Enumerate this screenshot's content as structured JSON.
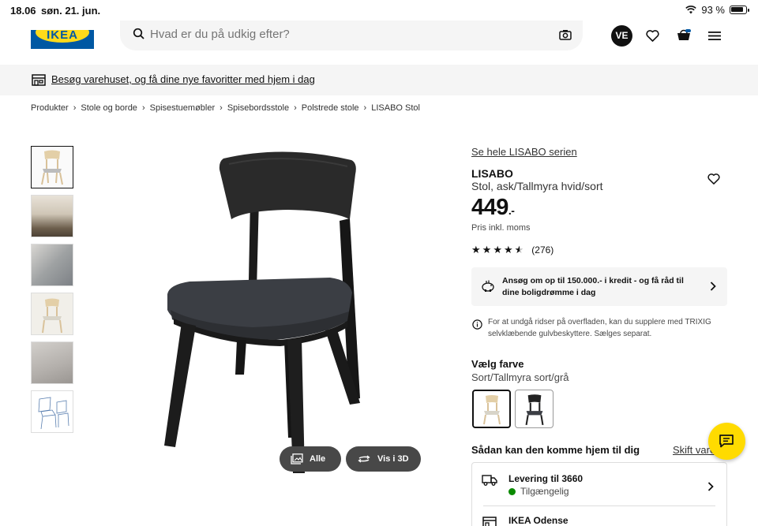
{
  "status_bar": {
    "time": "18.06",
    "date": "søn. 21. jun.",
    "url": "ikea.com",
    "battery": "93 %"
  },
  "header": {
    "logo_text": "IKEA",
    "search_placeholder": "Hvad er du på udkig efter?",
    "avatar_initials": "VE"
  },
  "banner": {
    "text": "Besøg varehuset, og få dine nye favoritter med hjem i dag"
  },
  "breadcrumb": [
    "Produkter",
    "Stole og borde",
    "Spisestuemøbler",
    "Spisebordsstole",
    "Polstrede stole",
    "LISABO Stol"
  ],
  "gallery": {
    "all_label": "Alle",
    "view_3d_label": "Vis i 3D"
  },
  "product": {
    "series_link": "Se hele LISABO serien",
    "name": "LISABO",
    "description": "Stol, ask/Tallmyra hvid/sort",
    "price": "449",
    "price_suffix": ".-",
    "vat_note": "Pris inkl. moms",
    "rating": 4.5,
    "review_count": "(276)",
    "credit_text": "Ansøg om op til 150.000.- i kredit - og få råd til dine boligdrømme i dag",
    "info_text": "For at undgå ridser på overfladen, kan du supplere med TRIXIG selvklæbende gulvbeskyttere. Sælges separat.",
    "color_title": "Vælg farve",
    "color_value": "Sort/Tallmyra sort/grå"
  },
  "delivery": {
    "title": "Sådan kan den komme hjem til dig",
    "change_store": "Skift vareh",
    "delivery_label": "Levering til 3660",
    "delivery_status": "Tilgængelig",
    "store_label": "IKEA Odense"
  },
  "colors": {
    "brand_blue": "#0058a3",
    "brand_yellow": "#ffda1a",
    "available_green": "#0a8a00"
  }
}
